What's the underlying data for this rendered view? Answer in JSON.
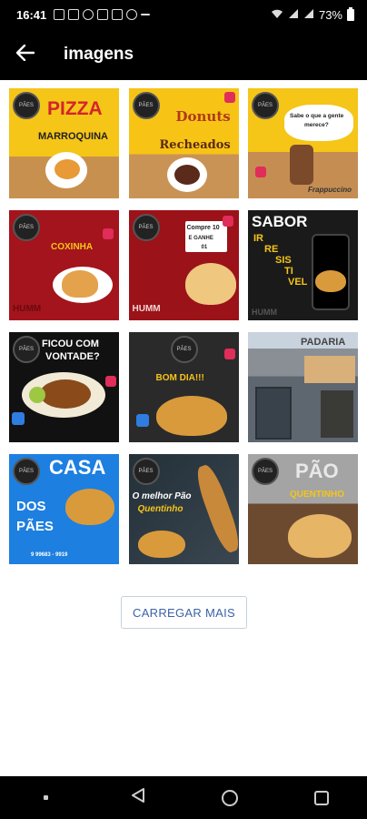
{
  "status_bar": {
    "time": "16:41",
    "battery_text": "73%",
    "icons": [
      "gallery-icon",
      "b-icon",
      "whatsapp-icon",
      "facebook-icon",
      "f-icon",
      "missed-call-icon",
      "dash-icon",
      "wifi-icon",
      "signal-icon",
      "signal-icon",
      "battery-icon"
    ]
  },
  "app_bar": {
    "back_icon": "arrow-left-icon",
    "title": "imagens"
  },
  "tiles": [
    {
      "line1": "PIZZA",
      "line2": "MARROQUINA"
    },
    {
      "line1": "Donuts",
      "line2": "Recheados"
    },
    {
      "line1": "Sabe o que a gente",
      "line2": "merece?",
      "line3": "Frappuccino"
    },
    {
      "line1": "COXINHA",
      "line2": "HUMM"
    },
    {
      "line1": "Compre 10",
      "line2": "E GANHE",
      "line3": "01",
      "line4": "HUMM"
    },
    {
      "line1": "SABOR",
      "line2": "IR",
      "line3": "RE",
      "line4": "SIS",
      "line5": "TI",
      "line6": "VEL",
      "line7": "HUMM"
    },
    {
      "line1": "FICOU COM",
      "line2": "VONTADE?"
    },
    {
      "line1": "BOM DIA!!!"
    },
    {
      "line1": "PADARIA"
    },
    {
      "line1": "CASA",
      "line2": "DOS",
      "line3": "PÃES",
      "line4": "9 99683 - 9919"
    },
    {
      "line1": "O melhor Pão",
      "line2": "Quentinho"
    },
    {
      "line1": "PÃO",
      "line2": "QUENTINHO"
    }
  ],
  "load_more_label": "CARREGAR MAIS",
  "nav_bar": {
    "icons": [
      "menu-dot-icon",
      "back-triangle-icon",
      "home-circle-icon",
      "recents-square-icon"
    ]
  },
  "colors": {
    "accent": "#3b63a8",
    "bar": "#000000",
    "background": "#ffffff"
  }
}
